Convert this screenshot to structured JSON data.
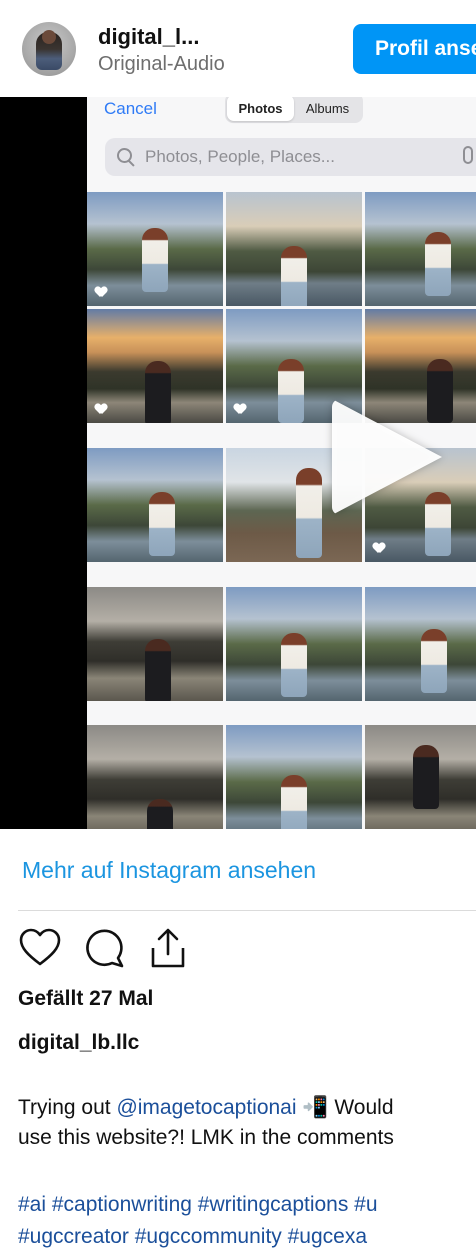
{
  "header": {
    "username": "digital_l...",
    "audio": "Original-Audio",
    "profile_button": "Profil ansehen"
  },
  "video": {
    "cancel_label": "Cancel",
    "tabs": [
      "Photos",
      "Albums"
    ],
    "active_tab": "Photos",
    "search_placeholder": "Photos, People, Places...",
    "state": "paused"
  },
  "post": {
    "more_link": "Mehr auf Instagram ansehen",
    "likes": "Gefällt 27 Mal",
    "author": "digital_lb.llc",
    "caption_line1_pre": "Trying out ",
    "caption_mention": "@imagetocaptionai",
    "caption_line1_post": " 📲 Would",
    "caption_line2": "use this website?! LMK in the comments",
    "hashtags_line1": "#ai #captionwriting #writingcaptions #u",
    "hashtags_line2": "#ugccreator #ugccommunity #ugcexa"
  },
  "icons": {
    "like": "heart-icon",
    "comment": "comment-icon",
    "share": "share-icon",
    "play": "play-icon"
  },
  "colors": {
    "accent": "#0095f6",
    "link": "#1b95e0",
    "hashtag": "#1b4f9a"
  }
}
